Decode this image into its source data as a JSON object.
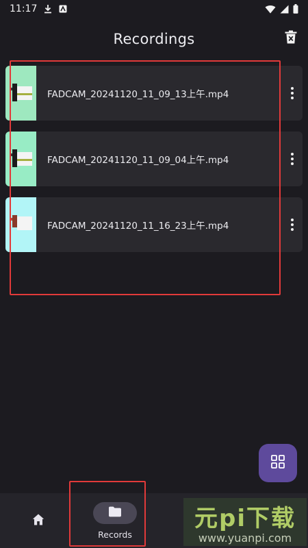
{
  "status_bar": {
    "time": "11:17",
    "icons": [
      "download-icon",
      "app-notification-icon",
      "wifi-icon",
      "signal-icon",
      "battery-icon"
    ]
  },
  "app_bar": {
    "title": "Recordings",
    "delete_icon": "delete-all-icon"
  },
  "recordings": [
    {
      "file_name": "FADCAM_20241120_11_09_13上午.mp4",
      "thumb_color": "#9ee8bf"
    },
    {
      "file_name": "FADCAM_20241120_11_09_04上午.mp4",
      "thumb_color": "#98ecc5"
    },
    {
      "file_name": "FADCAM_20241120_11_16_23上午.mp4",
      "thumb_color": "#b2f5f7"
    }
  ],
  "fab": {
    "icon": "grid-view-icon",
    "color": "#5e4a9c"
  },
  "bottom_nav": {
    "items": [
      {
        "icon": "home-icon",
        "label": ""
      },
      {
        "icon": "folder-icon",
        "label": "Records",
        "selected": true
      }
    ]
  },
  "watermark": {
    "main": "元pi下载",
    "sub": "www.yuanpi.com"
  },
  "colors": {
    "background": "#1c1b20",
    "card": "#2a292e",
    "highlight": "#e23a3a",
    "accent": "#5e4a9c"
  }
}
